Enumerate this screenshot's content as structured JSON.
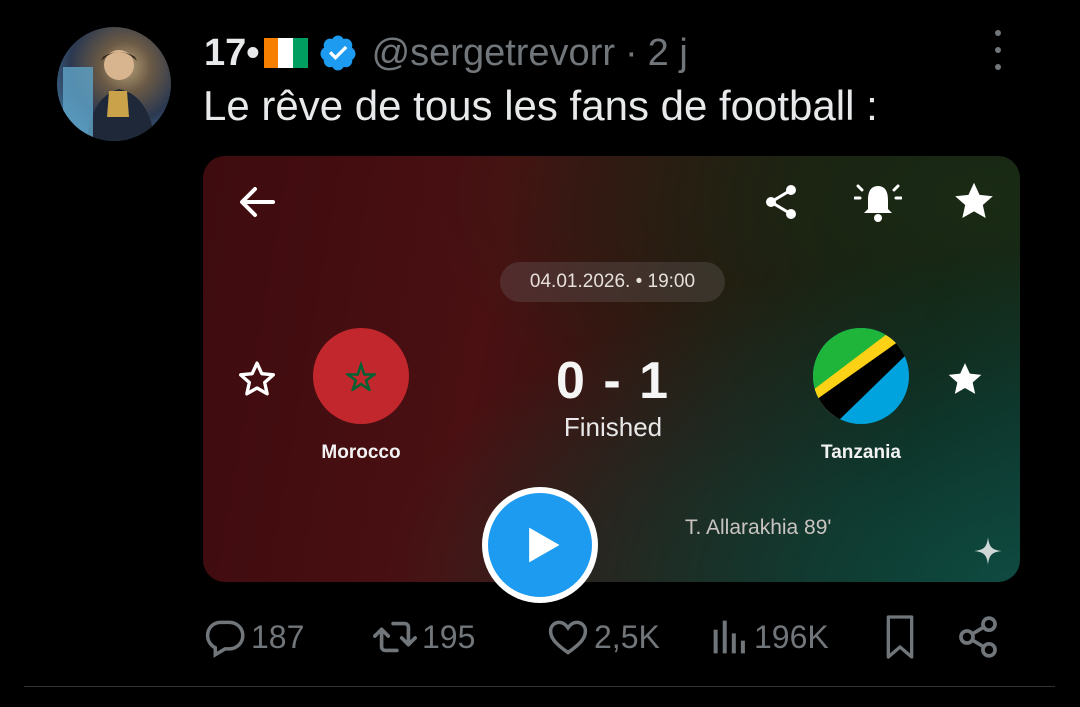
{
  "tweet": {
    "display_name": "17•",
    "flag": "Côte d'Ivoire",
    "verified": true,
    "handle": "@sergetrevorr",
    "separator": "·",
    "time": "2 j",
    "text": "Le rêve de tous les fans de football :"
  },
  "media": {
    "date_time": "04.01.2026. • 19:00",
    "home_team": "Morocco",
    "away_team": "Tanzania",
    "score": "0 - 1",
    "status": "Finished",
    "scorer": "T. Allarakhia 89'",
    "icons": [
      "back-arrow-icon",
      "share-icon",
      "bell-icon",
      "star-icon",
      "sparkle-icon",
      "play-icon"
    ]
  },
  "actions": {
    "replies": "187",
    "reposts": "195",
    "likes": "2,5K",
    "views": "196K"
  },
  "colors": {
    "background": "#000000",
    "verified_blue": "#1d9bf0",
    "muted_text": "#71767b",
    "morocco_red": "#c1272d",
    "tanzania_green": "#1eb53a",
    "tanzania_blue": "#00a3dd",
    "tanzania_yellow": "#fcd116"
  }
}
